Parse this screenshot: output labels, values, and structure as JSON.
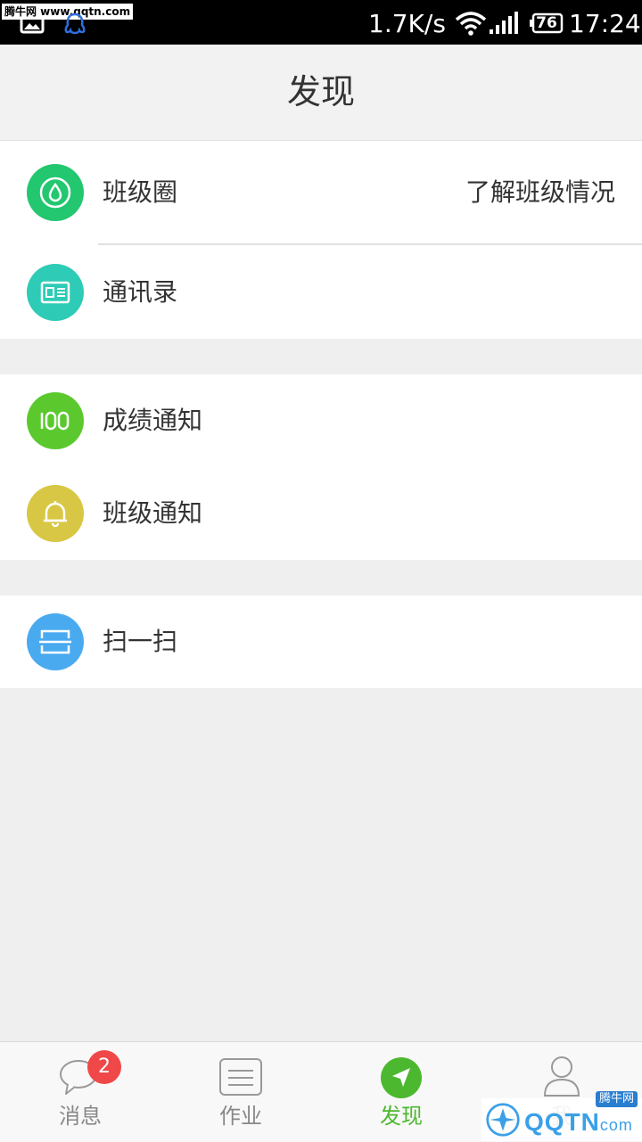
{
  "status_bar": {
    "watermark": "腾牛网 www.qqtn.com",
    "speed": "1.7K/s",
    "battery": "76",
    "time": "17:24"
  },
  "header": {
    "title": "发现"
  },
  "groups": [
    {
      "items": [
        {
          "label": "班级圈",
          "right": "了解班级情况",
          "icon": "drop-icon",
          "color": "#22c76f"
        },
        {
          "label": "通讯录",
          "icon": "contact-card-icon",
          "color": "#2ecbb6"
        }
      ]
    },
    {
      "items": [
        {
          "label": "成绩通知",
          "icon": "score-100-icon",
          "color": "#5bc92e"
        },
        {
          "label": "班级通知",
          "icon": "bell-icon",
          "color": "#d8c744"
        }
      ]
    },
    {
      "items": [
        {
          "label": "扫一扫",
          "icon": "scan-icon",
          "color": "#4aaaf0"
        }
      ]
    }
  ],
  "tabbar": {
    "tabs": [
      {
        "label": "消息",
        "badge": "2",
        "icon": "chat-bubble-icon"
      },
      {
        "label": "作业",
        "icon": "document-icon"
      },
      {
        "label": "发现",
        "icon": "navigation-arrow-icon",
        "active": true
      },
      {
        "label": "我",
        "icon": "person-icon"
      }
    ],
    "active_color": "#4cb82f"
  },
  "watermark": {
    "brand": "QQTN",
    "suffix": "com",
    "tag": "腾牛网"
  }
}
